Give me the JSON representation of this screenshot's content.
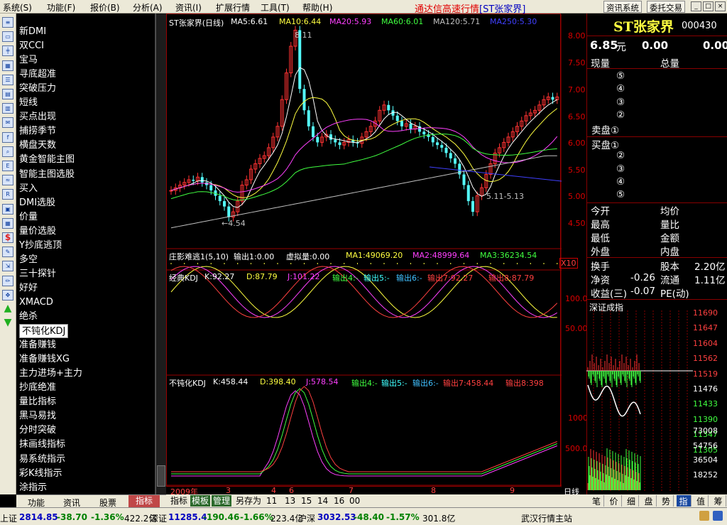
{
  "menu": [
    "系统(S)",
    "功能(F)",
    "报价(B)",
    "分析(A)",
    "资讯(I)",
    "扩展行情",
    "工具(T)",
    "帮助(H)"
  ],
  "app_title": "通达信高速行情",
  "app_title_stock": "[ST张家界]",
  "buttons": {
    "info_system": "资讯系统",
    "delegate_trade": "委托交易"
  },
  "window_controls": [
    "_",
    "□",
    "×"
  ],
  "left_tool_icons": [
    "list-icon",
    "chart-icon",
    "candle-icon",
    "trend-icon",
    "table-icon",
    "grid-icon",
    "bars-icon",
    "news-icon",
    "f10-icon",
    "search-icon",
    "etf-icon",
    "wave-icon",
    "rsi-icon",
    "panel-icon",
    "calendar-icon",
    "money-icon",
    "tools-icon",
    "export-icon",
    "pencil-icon",
    "move-icon",
    "up-arrow-icon",
    "down-arrow-icon"
  ],
  "indicators": [
    "新DMI",
    "双CCI",
    "宝马",
    "寻底超准",
    "突破压力",
    "短线",
    "买点出现",
    "捕捞季节",
    "横盘天数",
    "黄金智能主图",
    "智能主图选股",
    "买入",
    "DMI选股",
    "价量",
    "量价选股",
    "Y抄底逃顶",
    "多空",
    "三十探针",
    "好好",
    "XMACD",
    "绝杀",
    "不钝化KDJ",
    "准备赚钱",
    "准备赚钱XG",
    "主力进场+主力",
    "抄底绝准",
    "量比指标",
    "黑马易找",
    "分时突破",
    "抹画线指标",
    "易系统指示",
    "彩K线指示",
    "涂指示"
  ],
  "selected_indicator": "不钝化KDJ",
  "left_tabs": [
    "功能",
    "资讯",
    "股票",
    "指标"
  ],
  "active_left_tab": "指标",
  "main_legend": {
    "name": "ST张家界(日线)",
    "ma5": "MA5:6.61",
    "ma10": "MA10:6.44",
    "ma20": "MA20:5.93",
    "ma60": "MA60:6.01",
    "ma120": "MA120:5.71",
    "ma250": "MA250:5.30"
  },
  "price_ticks": [
    "8.00",
    "7.50",
    "7.00",
    "6.50",
    "6.00",
    "5.50",
    "5.00",
    "4.50"
  ],
  "annotations": {
    "high": "8.11",
    "low": "←4.54",
    "range": "5.11-5.13"
  },
  "vol_legend": {
    "name": "庄影难逃1(5,10)",
    "out1": "输出1:0.00",
    "virtual": "虚拟量:0.00",
    "ma1": "MA1:49069.20",
    "ma2": "MA2:48999.64",
    "ma3": "MA3:36234.54",
    "scale": "X10"
  },
  "kdj_legend": {
    "name": "经典KDJ",
    "k": "K:92.27",
    "d": "D:87.79",
    "j": "J:101.22",
    "o4": "输出4:-",
    "o5": "输出5:-",
    "o6": "输出6:-",
    "o7": "输出7:92.27",
    "o8": "输出8:87.79"
  },
  "kdj_ticks": [
    "100.0",
    "50.00"
  ],
  "bkdj_legend": {
    "name": "不钝化KDJ",
    "k": "K:458.44",
    "d": "D:398.40",
    "j": "J:578.54",
    "o4": "输出4:-",
    "o5": "输出5:-",
    "o6": "输出6:-",
    "o7": "输出7:458.44",
    "o8": "输出8:398"
  },
  "bkdj_ticks": [
    "1000",
    "500.0"
  ],
  "date_axis": [
    "2009年",
    "3",
    "4",
    "6",
    "7",
    "8",
    "9"
  ],
  "period": "日线",
  "chart_toolbar": [
    "指标",
    "模板",
    "管理",
    "另存为",
    "11",
    "13",
    "15",
    "14",
    "16",
    "00"
  ],
  "quote": {
    "name": "ST张家界",
    "code": "000430",
    "price": "6.85",
    "unit": "元",
    "change": "0.00",
    "change2": "0.00",
    "col_price": "现量",
    "col_vol": "总量",
    "sell_levels": [
      "⑤",
      "④",
      "③",
      "②",
      "卖盘①"
    ],
    "buy_levels": [
      "买盘①",
      "②",
      "③",
      "④",
      "⑤"
    ],
    "left_labels": [
      "今开",
      "最高",
      "最低",
      "外盘"
    ],
    "right_labels": [
      "均价",
      "量比",
      "金额",
      "内盘"
    ],
    "turnover_label": "换手",
    "capital_label": "股本",
    "capital_value": "2.20亿",
    "net_asset_label": "净资",
    "net_asset_value": "-0.26",
    "float_label": "流通",
    "float_value": "1.11亿",
    "eps_label": "收益(三)",
    "eps_value": "-0.07",
    "pe_label": "PE(动)"
  },
  "index_panel": {
    "title": "深证成指",
    "ticks": [
      "11690",
      "11647",
      "11604",
      "11562",
      "11519",
      "11476",
      "11433",
      "11390",
      "11347",
      "11305"
    ],
    "vol_ticks": [
      "73008",
      "54756",
      "36504",
      "18252"
    ]
  },
  "right_tabs": [
    "笔",
    "价",
    "细",
    "盘",
    "势",
    "指",
    "值",
    "筹"
  ],
  "active_right_tab": "指",
  "status": {
    "sh_label": "上证",
    "sh_value": "2814.85",
    "sh_change": "-38.70",
    "sh_pct": "-1.36%",
    "sh_amt": "422.2亿",
    "sz_label": "深证",
    "sz_value": "11285.4",
    "sz_change": "-190.46",
    "sz_pct": "-1.66%",
    "sz_amt": "223.4亿",
    "hs_label": "沪深",
    "hs_value": "3032.53",
    "hs_change": "-48.40",
    "hs_pct": "-1.57%",
    "hs_amt": "301.8亿",
    "server": "武汉行情主站"
  }
}
